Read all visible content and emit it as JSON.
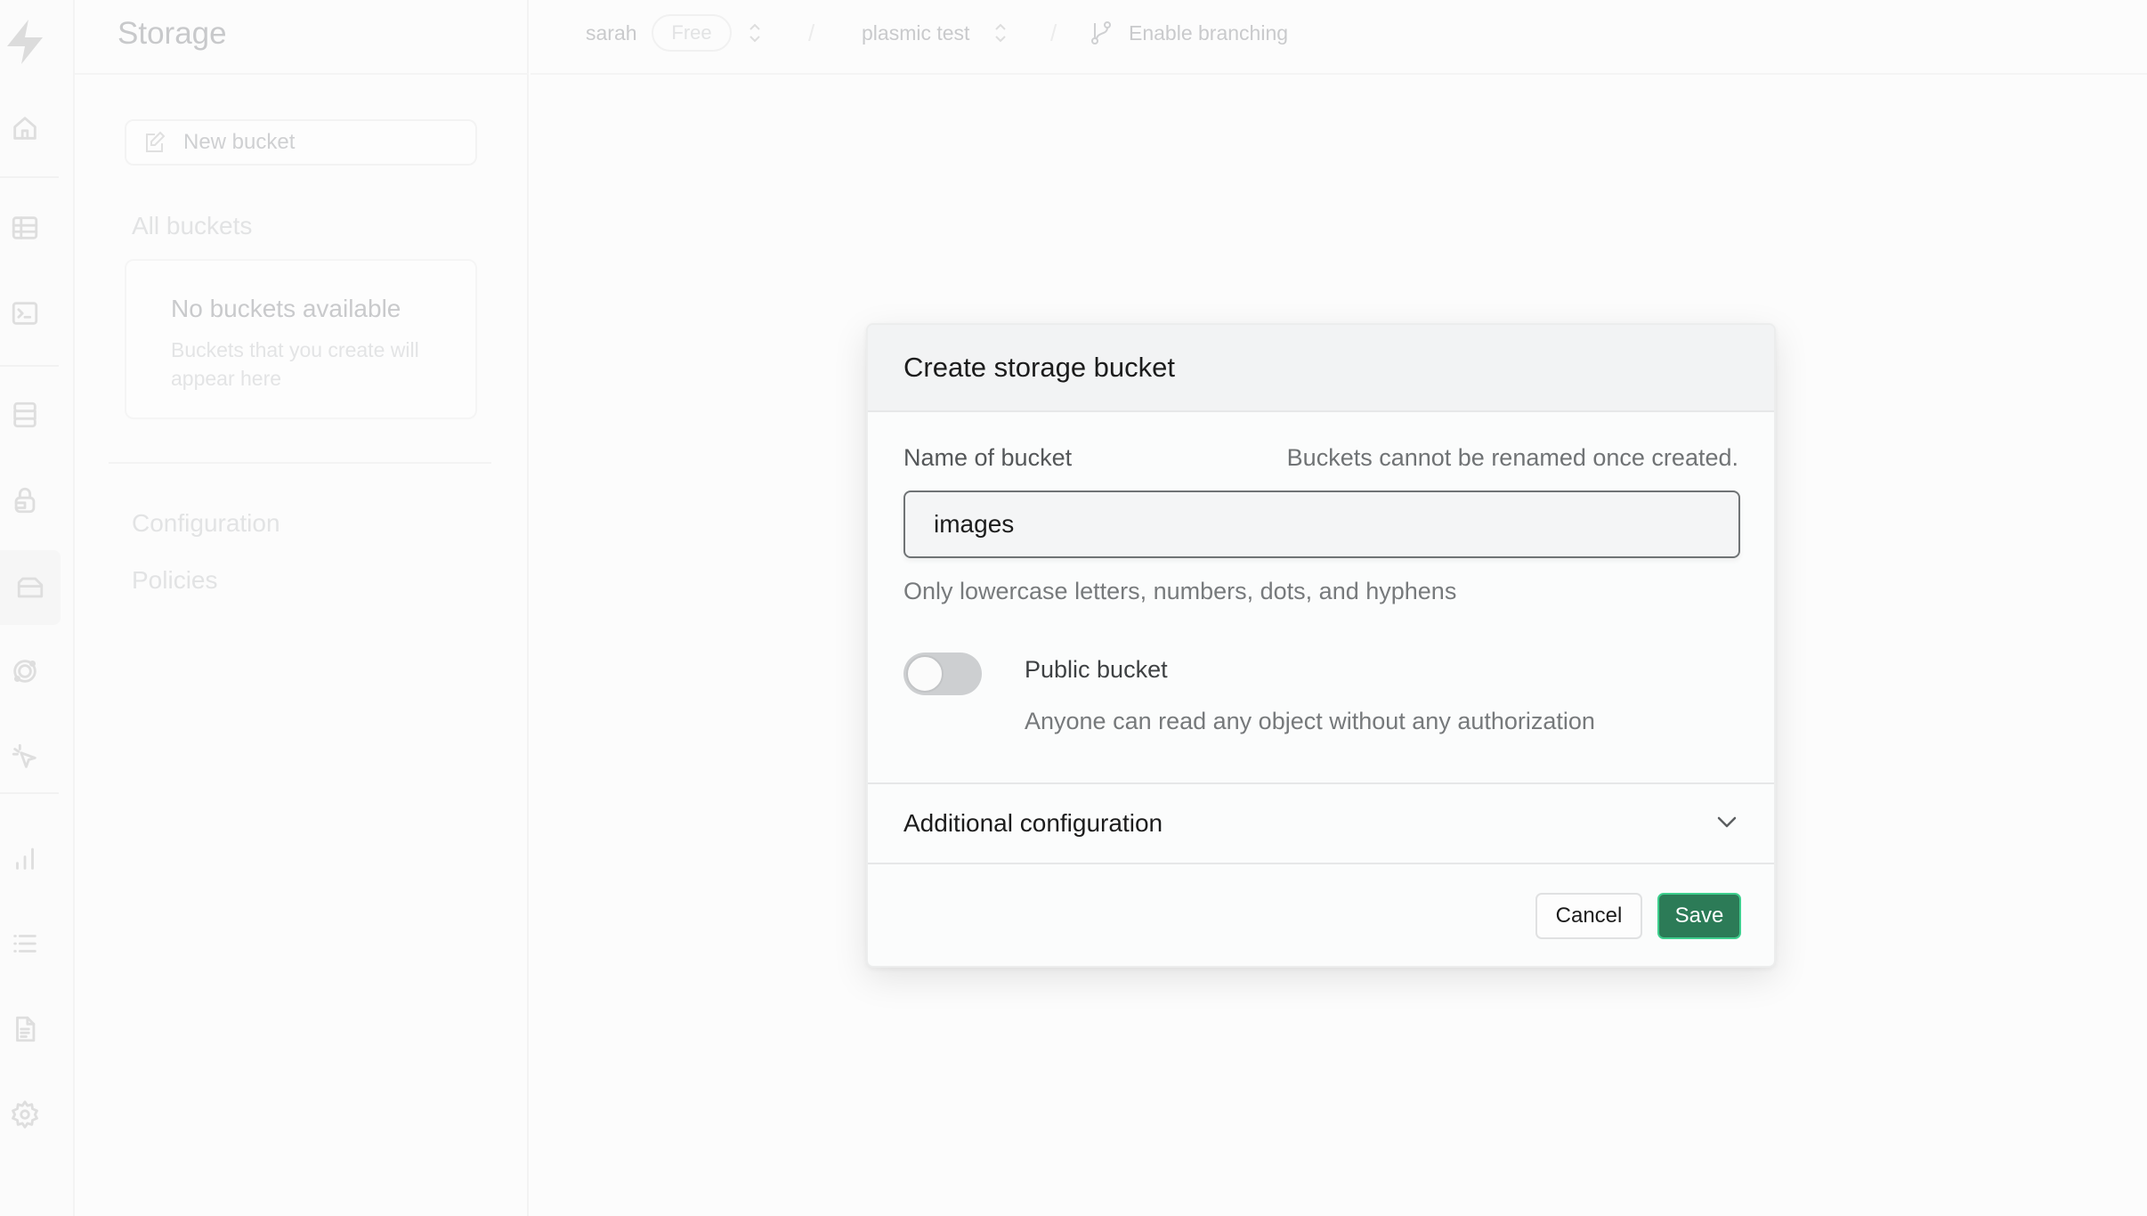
{
  "rail": {
    "items": [
      {
        "name": "home",
        "icon": "home-icon"
      },
      {
        "name": "table-editor",
        "icon": "table-icon"
      },
      {
        "name": "sql-editor",
        "icon": "terminal-icon"
      },
      {
        "name": "database",
        "icon": "database-icon"
      },
      {
        "name": "authentication",
        "icon": "lock-icon"
      },
      {
        "name": "storage",
        "icon": "folder-icon",
        "active": true
      },
      {
        "name": "edge-functions",
        "icon": "globe-icon"
      },
      {
        "name": "realtime",
        "icon": "pointer-icon"
      },
      {
        "name": "reports",
        "icon": "bar-chart-icon"
      },
      {
        "name": "logs",
        "icon": "list-icon"
      },
      {
        "name": "api-docs",
        "icon": "document-icon"
      },
      {
        "name": "settings",
        "icon": "gear-icon"
      }
    ]
  },
  "panel": {
    "title": "Storage",
    "new_bucket_label": "New bucket",
    "all_buckets_label": "All buckets",
    "empty_title": "No buckets available",
    "empty_subtitle": "Buckets that you create will appear here",
    "menu": [
      "Configuration",
      "Policies"
    ]
  },
  "topbar": {
    "org": "sarah",
    "plan": "Free",
    "separator": "/",
    "project": "plasmic test",
    "branching": "Enable branching"
  },
  "modal": {
    "title": "Create storage bucket",
    "name_label": "Name of bucket",
    "name_note": "Buckets cannot be renamed once created.",
    "name_value": "images",
    "name_help": "Only lowercase letters, numbers, dots, and hyphens",
    "public_label": "Public bucket",
    "public_description": "Anyone can read any object without any authorization",
    "public_enabled": false,
    "additional_config_label": "Additional configuration",
    "cancel_label": "Cancel",
    "save_label": "Save"
  },
  "colors": {
    "primary": "#2c7b57",
    "primary_border": "#3ecf8e"
  }
}
